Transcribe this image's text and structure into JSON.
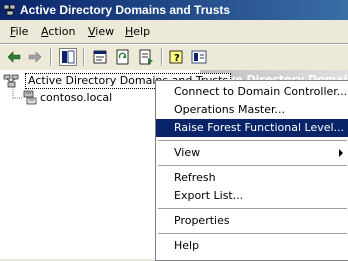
{
  "window": {
    "title": "Active Directory Domains and Trusts"
  },
  "menubar": [
    {
      "label": "File",
      "access": "F"
    },
    {
      "label": "Action",
      "access": "A"
    },
    {
      "label": "View",
      "access": "V"
    },
    {
      "label": "Help",
      "access": "H"
    }
  ],
  "tree": {
    "root_label": "Active Directory Domains and Trusts",
    "child_label": "contoso.local"
  },
  "rightpane": {
    "title": "Active Directory Domains and Trusts"
  },
  "context_menu": {
    "items": [
      "Connect to Domain Controller...",
      "Operations Master...",
      "Raise Forest Functional Level...",
      "View",
      "Refresh",
      "Export List...",
      "Properties",
      "Help"
    ],
    "selected_index": 2
  },
  "colors": {
    "titlebar": "#0a246a",
    "selection": "#0a246a",
    "face": "#ece9d8"
  }
}
